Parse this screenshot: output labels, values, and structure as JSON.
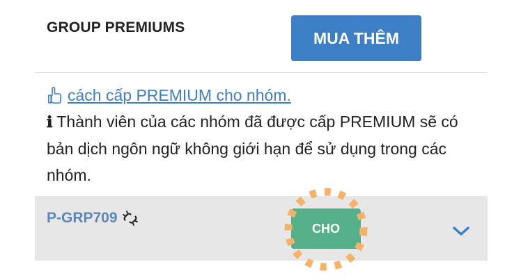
{
  "header": {
    "title": "GROUP PREMIUMS",
    "buy_button_label": "MUA THÊM"
  },
  "info": {
    "howto_link": "cách cấp PREMIUM cho nhóm.",
    "description": "Thành viên của các nhóm đã được cấp PREMIUM sẽ có bản dịch ngôn ngữ không giới hạn để sử dụng trong các nhóm."
  },
  "group": {
    "id": "P-GRP709",
    "give_button_label": "CHO"
  },
  "icons": {
    "hand": "pointing-hand-icon",
    "info": "info-icon",
    "unlink": "unlink-icon",
    "chevron": "chevron-down-icon"
  },
  "colors": {
    "accent_blue": "#3d7fc4",
    "give_green": "#55b08a",
    "highlight_orange": "#f5b26b",
    "row_background": "#e7e7e7"
  }
}
